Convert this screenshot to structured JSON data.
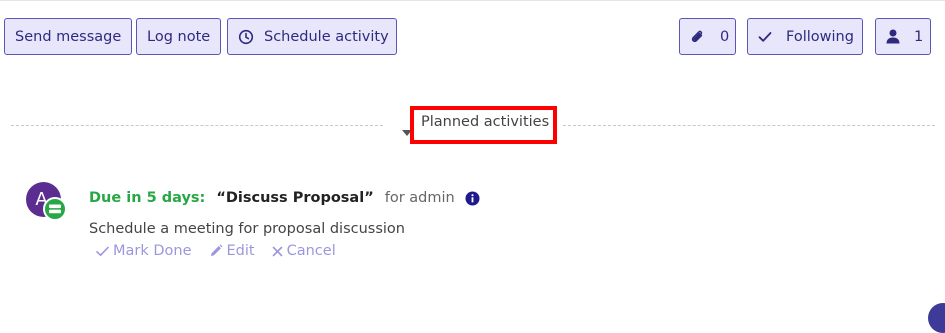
{
  "toolbar": {
    "send_message": "Send message",
    "log_note": "Log note",
    "schedule_activity": "Schedule activity",
    "attachments_count": "0",
    "following": "Following",
    "followers_count": "1"
  },
  "section": {
    "title": "Planned activities"
  },
  "activity": {
    "avatar_initial": "A",
    "due_label": "Due in 5 days:",
    "summary": "“Discuss Proposal”",
    "assigned": "for admin",
    "note": "Schedule a meeting for proposal discussion",
    "actions": {
      "mark_done": "Mark Done",
      "edit": "Edit",
      "cancel": "Cancel"
    }
  },
  "colors": {
    "accent": "#5a56b8",
    "button_bg": "#e7e6fb",
    "due_green": "#28a745",
    "highlight": "#ff0000",
    "avatar_purple": "#5b2d90"
  },
  "icons": [
    "clock-icon",
    "paperclip-icon",
    "check-icon",
    "user-icon",
    "caret-down-icon",
    "info-icon",
    "activity-badge-icon",
    "pencil-icon",
    "close-icon"
  ]
}
